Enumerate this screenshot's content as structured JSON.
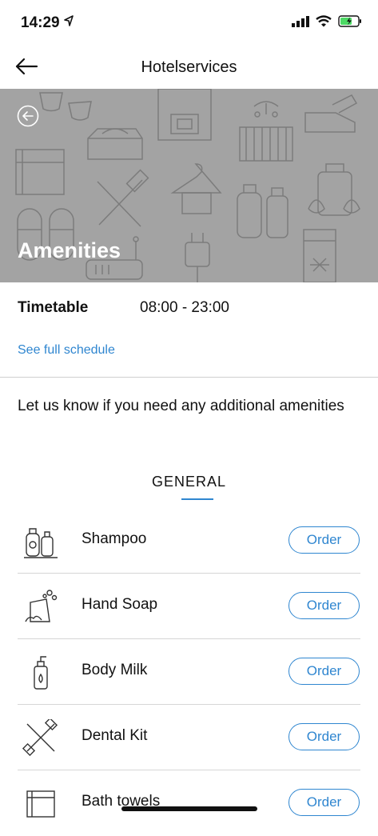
{
  "status_bar": {
    "time": "14:29"
  },
  "nav": {
    "title": "Hotelservices"
  },
  "hero": {
    "title": "Amenities"
  },
  "timetable": {
    "label": "Timetable",
    "value": "08:00 - 23:00",
    "link": "See full schedule"
  },
  "intro": "Let us know if you need any additional amenities",
  "section_title": "GENERAL",
  "items": [
    {
      "name": "Shampoo",
      "icon": "shampoo-icon",
      "order_label": "Order"
    },
    {
      "name": "Hand Soap",
      "icon": "hand-soap-icon",
      "order_label": "Order"
    },
    {
      "name": "Body Milk",
      "icon": "body-milk-icon",
      "order_label": "Order"
    },
    {
      "name": "Dental Kit",
      "icon": "dental-kit-icon",
      "order_label": "Order"
    },
    {
      "name": "Bath towels",
      "icon": "bath-towels-icon",
      "order_label": "Order"
    }
  ],
  "colors": {
    "accent": "#2f86d0",
    "hero_bg": "#a3a3a3"
  }
}
